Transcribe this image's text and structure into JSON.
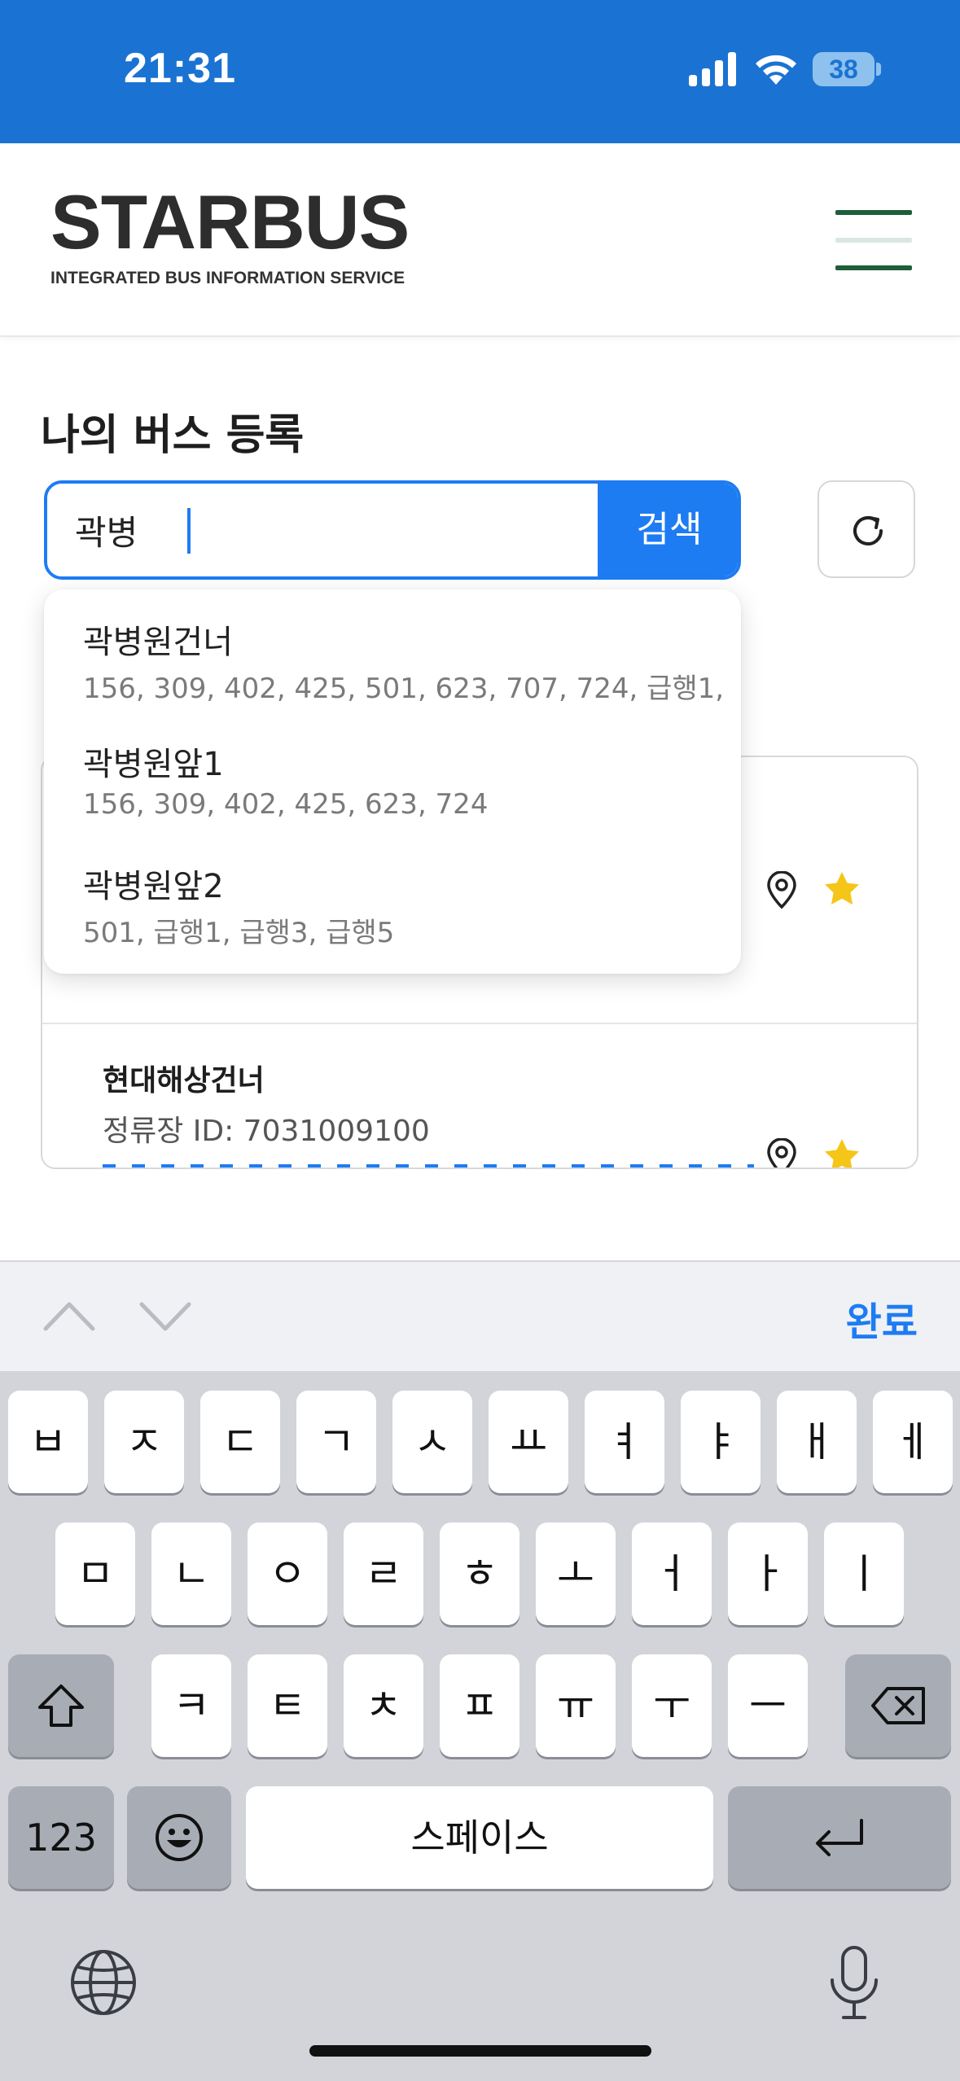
{
  "status_bar": {
    "time": "21:31",
    "battery": "38",
    "battery_level": 0.38,
    "background": "#1a73d2"
  },
  "header": {
    "logo_title": "STARBUS",
    "logo_subtitle": "INTEGRATED BUS INFORMATION SERVICE",
    "menu_colors": [
      "#1e5e3a",
      "#d9e8df",
      "#1e5e3a"
    ]
  },
  "main": {
    "section_title": "나의 버스 등록",
    "search": {
      "value": "곽병",
      "button_label": "검색"
    },
    "suggestions": [
      {
        "name": "곽병원건너",
        "routes": "156, 309, 402, 425, 501, 623, 707, 724, 급행1,"
      },
      {
        "name": "곽병원앞1",
        "routes": "156, 309, 402, 425, 623, 724"
      },
      {
        "name": "곽병원앞2",
        "routes": "501, 급행1, 급행3, 급행5"
      }
    ],
    "saved_stops": [
      {
        "name": "현대해상건너",
        "stop_id": "정류장 ID: 7031009100"
      }
    ]
  },
  "keyboard": {
    "toolbar_done": "완료",
    "row1": [
      "ㅂ",
      "ㅈ",
      "ㄷ",
      "ㄱ",
      "ㅅ",
      "ㅛ",
      "ㅕ",
      "ㅑ",
      "ㅐ",
      "ㅔ"
    ],
    "row2": [
      "ㅁ",
      "ㄴ",
      "ㅇ",
      "ㄹ",
      "ㅎ",
      "ㅗ",
      "ㅓ",
      "ㅏ",
      "ㅣ"
    ],
    "row3": [
      "ㅋ",
      "ㅌ",
      "ㅊ",
      "ㅍ",
      "ㅠ",
      "ㅜ",
      "ㅡ"
    ],
    "numbers_key": "123",
    "space_key": "스페이스",
    "icons": [
      "shift-icon",
      "backspace-icon",
      "emoji-icon",
      "return-icon",
      "globe-icon",
      "microphone-icon"
    ]
  },
  "colors": {
    "accent": "#1e7cf2",
    "star": "#f5c518",
    "keyboard_bg": "#d2d4da"
  }
}
